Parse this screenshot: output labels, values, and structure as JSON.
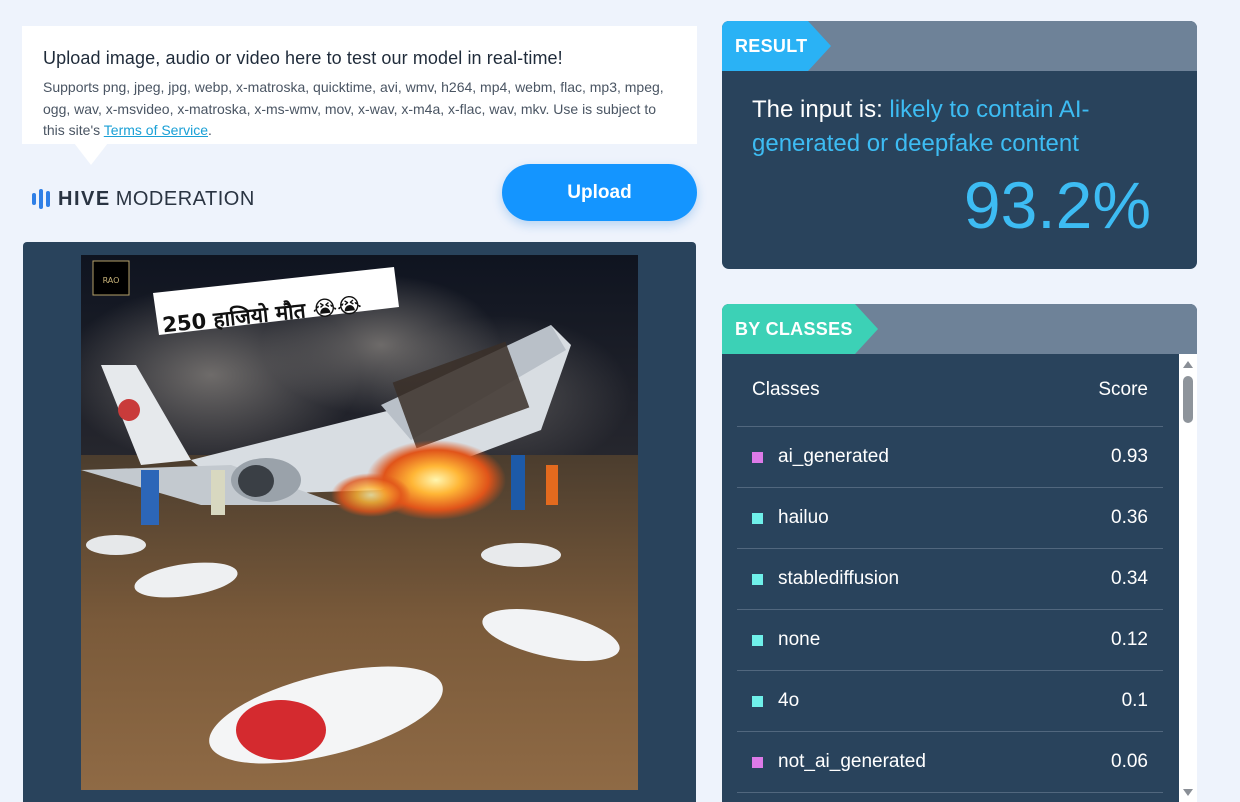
{
  "upload_info": {
    "headline": "Upload image, audio or video here to test our model in real-time!",
    "support_text": "Supports png, jpeg, jpg, webp, x-matroska, quicktime, avi, wmv, h264, mp4, webm, flac, mp3, mpeg, ogg, wav, x-msvideo, x-matroska, x-ms-wmv, mov, x-wav, x-m4a, x-flac, wav, mkv. Use is subject to this site's ",
    "terms_link": "Terms of Service",
    "terms_suffix": "."
  },
  "brand": {
    "hive": "HIVE",
    "moderation": "MODERATION",
    "accent": "#2f7fe6"
  },
  "upload_button": {
    "label": "Upload",
    "color": "#1495ff"
  },
  "image": {
    "caption": "250 हाजियो मौत 😭😭",
    "watermark": "RAO",
    "description_icon": "uploaded-image"
  },
  "result": {
    "tag": "RESULT",
    "prefix": "The input is: ",
    "verdict": "likely to contain AI-generated or deepfake content",
    "percentage": "93.2%",
    "accent": "#3dbcf3"
  },
  "classes": {
    "tag": "BY CLASSES",
    "header_class": "Classes",
    "header_score": "Score",
    "rows": [
      {
        "name": "ai_generated",
        "score": "0.93",
        "color": "#dd7ae8"
      },
      {
        "name": "hailuo",
        "score": "0.36",
        "color": "#6ff0ea"
      },
      {
        "name": "stablediffusion",
        "score": "0.34",
        "color": "#6ff0ea"
      },
      {
        "name": "none",
        "score": "0.12",
        "color": "#6ff0ea"
      },
      {
        "name": "4o",
        "score": "0.1",
        "color": "#6ff0ea"
      },
      {
        "name": "not_ai_generated",
        "score": "0.06",
        "color": "#dd7ae8"
      }
    ]
  }
}
